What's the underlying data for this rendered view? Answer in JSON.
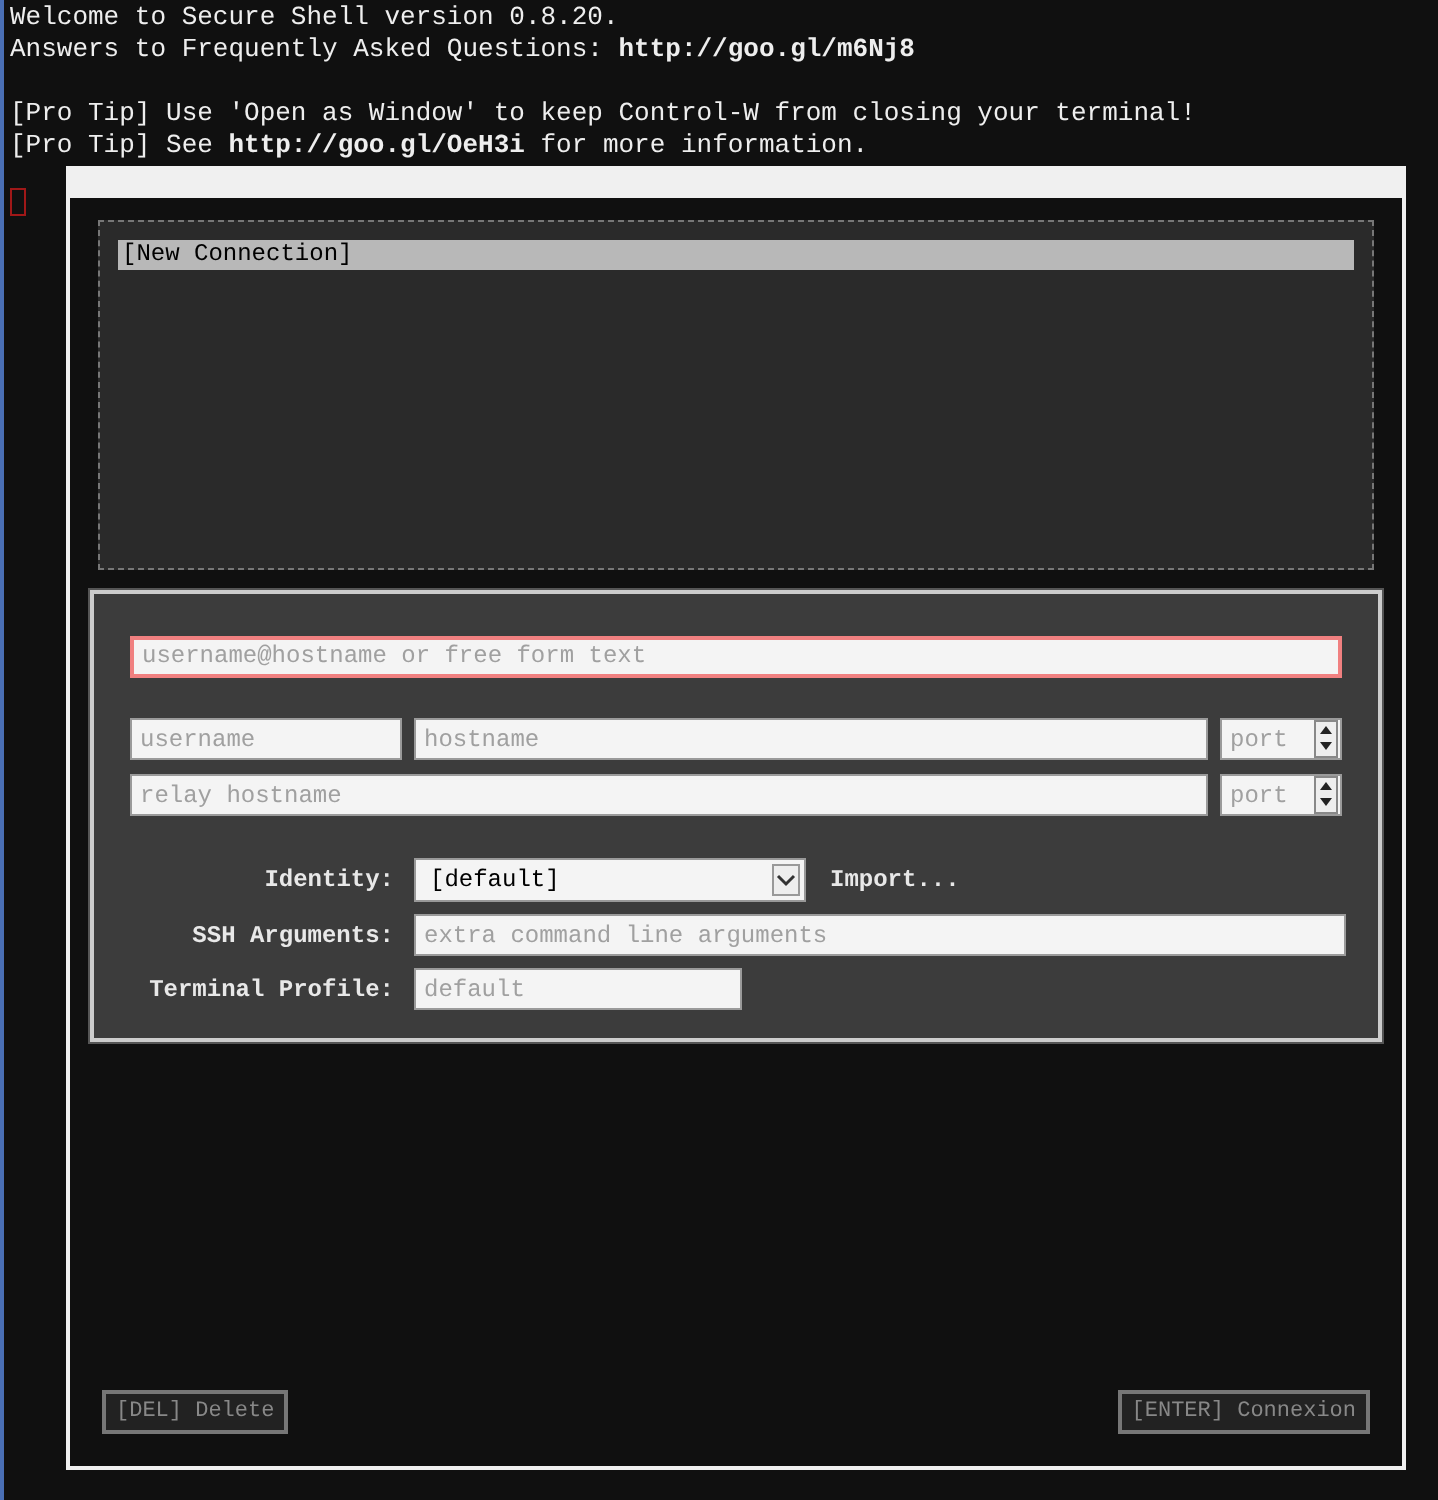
{
  "terminal": {
    "welcome_lines": [
      "Welcome to Secure Shell version 0.8.20.",
      "Answers to Frequently Asked Questions: **http://goo.gl/m6Nj8**"
    ],
    "tip_lines": [
      "[Pro Tip] Use 'Open as Window' to keep Control-W from closing your terminal!",
      "[Pro Tip] See **http://goo.gl/OeH3i** for more information."
    ]
  },
  "connections": [
    {
      "label": "[New Connection]",
      "selected": true
    }
  ],
  "form": {
    "destination": {
      "placeholder": "username@hostname or free form text",
      "focused": true
    },
    "username": {
      "placeholder": "username"
    },
    "hostname": {
      "placeholder": "hostname"
    },
    "port": {
      "placeholder": "port"
    },
    "relay_hostname": {
      "placeholder": "relay hostname"
    },
    "relay_port": {
      "placeholder": "port"
    },
    "identity": {
      "label": "Identity:",
      "value": "[default]",
      "import": "Import..."
    },
    "ssh_arguments": {
      "label": "SSH Arguments:",
      "placeholder": "extra command line arguments"
    },
    "terminal_profile": {
      "label": "Terminal Profile:",
      "placeholder": "default"
    }
  },
  "buttons": [
    {
      "label": "[DEL] Delete",
      "disabled": true
    },
    {
      "label": "[ENTER] Connexion",
      "disabled": true
    }
  ]
}
